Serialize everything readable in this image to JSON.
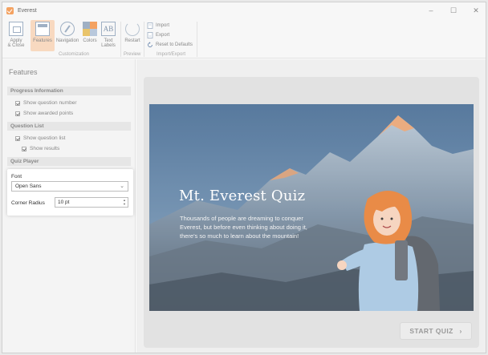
{
  "window": {
    "title": "Everest",
    "controls": [
      "–",
      "☐",
      "✕"
    ]
  },
  "ribbon": {
    "buttons": [
      {
        "label": "Apply\n& Close",
        "icon": "apply-close-icon"
      },
      {
        "label": "Features",
        "icon": "features-icon"
      },
      {
        "label": "Navigation",
        "icon": "navigation-icon"
      },
      {
        "label": "Colors",
        "icon": "colors-icon"
      },
      {
        "label": "Text\nLabels",
        "icon": "text-labels-icon",
        "glyph": "AB"
      },
      {
        "label": "Restart",
        "icon": "restart-icon"
      }
    ],
    "commands": [
      {
        "label": "Import",
        "icon": "import-icon"
      },
      {
        "label": "Export",
        "icon": "export-icon"
      },
      {
        "label": "Reset to Defaults",
        "icon": "reset-icon"
      }
    ],
    "groups": {
      "customization": "Customization",
      "preview": "Preview",
      "import_export": "Import/Export"
    }
  },
  "left_panel": {
    "title": "Features",
    "progress": {
      "header": "Progress Information",
      "show_question_number": "Show question number",
      "show_awarded_points": "Show awarded points"
    },
    "question_list": {
      "header": "Question List",
      "show_question_list": "Show question list",
      "show_results": "Show results"
    },
    "quiz_player": {
      "header": "Quiz Player",
      "font_label": "Font",
      "font_value": "Open Sans",
      "corner_radius_label": "Corner Radius",
      "corner_radius_value": "10 pt"
    }
  },
  "preview": {
    "title": "Mt. Everest Quiz",
    "description": "Thousands of people are dreaming to conquer Everest, but before even thinking about doing it, there's so much to learn about the mountain!",
    "start_button": "START QUIZ",
    "start_chevron": "›"
  },
  "colors": {
    "accent": "#f4a261",
    "active_ribbon": "#f8d9c0",
    "sky": "#5a7fa3",
    "hair": "#e8843c",
    "jacket": "#a9c8e3"
  }
}
